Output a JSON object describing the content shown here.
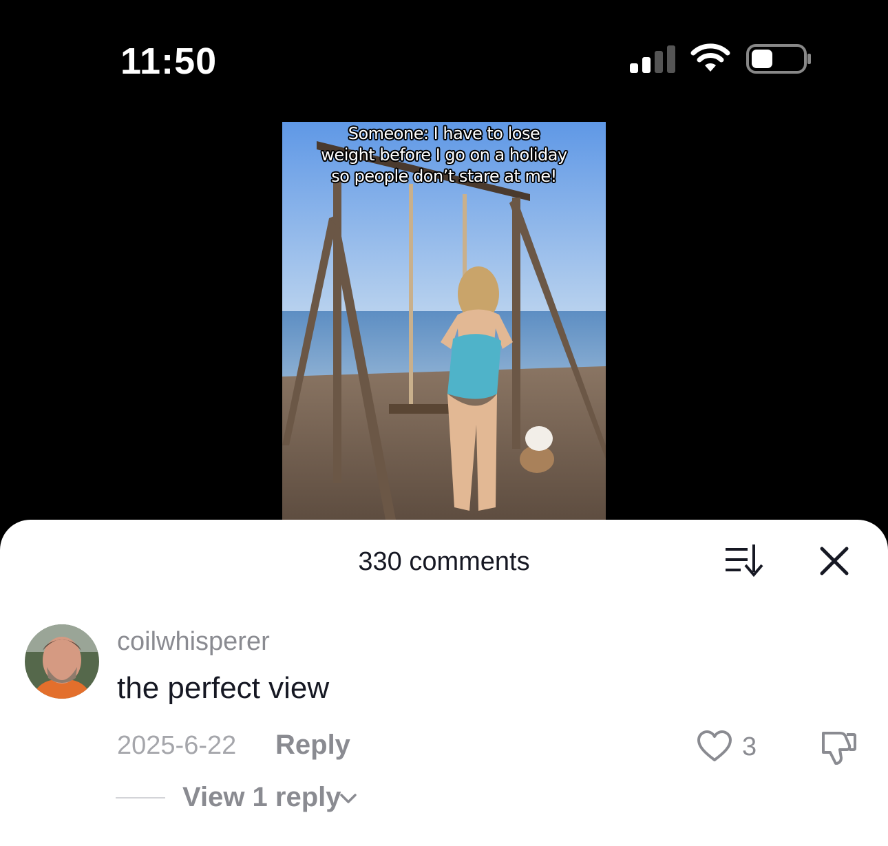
{
  "status_bar": {
    "time": "11:50",
    "icons": [
      "cellular-signal-icon",
      "wifi-icon",
      "battery-icon"
    ]
  },
  "video": {
    "caption_lines": [
      "Someone: I have to lose",
      "weight before I go on a holiday",
      "so people don’t stare at me!"
    ]
  },
  "comments_sheet": {
    "title": "330 comments",
    "icons": [
      "sort-icon",
      "close-icon"
    ],
    "comments": [
      {
        "username": "coilwhisperer",
        "text": "the perfect view",
        "date": "2025-6-22",
        "reply_label": "Reply",
        "likes": "3",
        "view_replies_label": "View 1 reply"
      }
    ]
  },
  "colors": {
    "background": "#000000",
    "sheet": "#ffffff",
    "primary_text": "#161823",
    "secondary_text": "#8a8b91"
  }
}
